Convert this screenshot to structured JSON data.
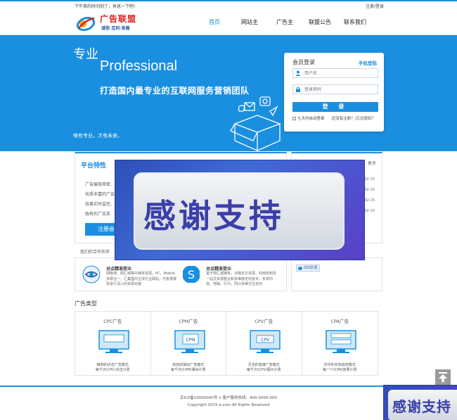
{
  "topbar": {
    "greeting": "下午茶的时间到了，休息一下吧!",
    "login_links": "注册/登录"
  },
  "logo": {
    "name": "广告联盟",
    "slogan": "诚信·互利·发展"
  },
  "nav": [
    {
      "label": "首页",
      "active": true
    },
    {
      "label": "网站主",
      "active": false
    },
    {
      "label": "广告主",
      "active": false
    },
    {
      "label": "联盟公告",
      "active": false
    },
    {
      "label": "联系我们",
      "active": false
    }
  ],
  "banner": {
    "title1": "专业",
    "title2": "Professional",
    "headline": "打造国内最专业的互联网服务营销团队",
    "tagline": "唯有专业，才有未来。"
  },
  "login": {
    "title": "会员登录",
    "mobile_login": "手机登陆",
    "username_placeholder": "用户名",
    "password_placeholder": "登录密码",
    "submit": "登 录",
    "remember": "七天内自动登录",
    "links": "还没有注册？/忘记密码？"
  },
  "features": {
    "title": "平台特性",
    "lines": [
      "广告展现简单,",
      "优质丰富的广告",
      "效果实时监控,",
      "独有的广告奖"
    ],
    "button": "注册会"
  },
  "notice": {
    "more": "更多",
    "dates": [
      "02-15",
      "02-15",
      "02-15",
      "02-15"
    ]
  },
  "overlay_text": "感谢支持",
  "partners": {
    "label": "我们的合作伙伴",
    "items": [
      {
        "title": "对点精准受众",
        "desc": "网络通、网汇城等众媒体资源，PC、Mobile多屏合一，汇集国内主流行业网站，与各类媒体进行深入的资源对接"
      },
      {
        "title": "对点精准受众",
        "desc": "基于网汇城媒体，对媒多方资源，利用定制月一站式资源整合和多维度定向技术，实现内容、地域、行为、同兴多维方位定向"
      }
    ],
    "qq_label": "QQ交谈"
  },
  "adtypes": {
    "label": "广告类型",
    "items": [
      {
        "title": "CPC广告",
        "desc1": "精准的点击广告模式",
        "desc2": "每千次(CPC)点击计费"
      },
      {
        "title": "CPM广告",
        "desc1": "高效的弹出广告模式",
        "desc2": "每千次(CPM)弹出计费",
        "screen_label": "CPM"
      },
      {
        "title": "CPV广告",
        "desc1": "灵活的富媒广告模式",
        "desc2": "每千次(CPV)展示计费",
        "screen_label": "CPV"
      },
      {
        "title": "CPA广告",
        "desc1": "你中的实际成效模式",
        "desc2": "每一个(CPA)效果计费"
      }
    ]
  },
  "footer": {
    "icp": "京ICP备10000000号-1 客户服务热线：400-0000-000",
    "copyright": "Copyright 2015 a.com All Rights Reserved"
  },
  "corner_text": "感谢支持"
}
